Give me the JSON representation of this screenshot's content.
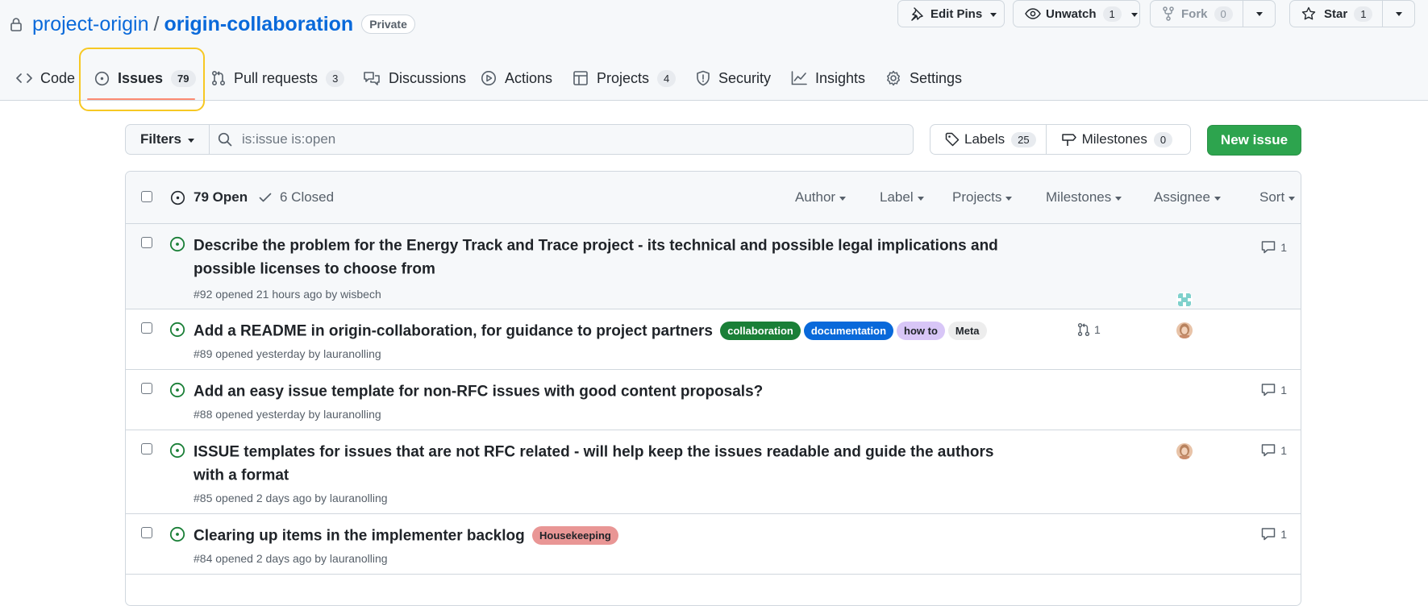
{
  "repo": {
    "owner": "project-origin",
    "separator": "/",
    "name": "origin-collaboration",
    "visibility": "Private"
  },
  "actions": {
    "edit_pins": "Edit Pins",
    "unwatch": "Unwatch",
    "unwatch_count": "1",
    "fork": "Fork",
    "fork_count": "0",
    "star": "Star",
    "star_count": "1"
  },
  "tabs": [
    {
      "label": "Code",
      "icon": "code-icon"
    },
    {
      "label": "Issues",
      "icon": "issue-opened-icon",
      "count": "79",
      "active": true
    },
    {
      "label": "Pull requests",
      "icon": "git-pull-request-icon",
      "count": "3"
    },
    {
      "label": "Discussions",
      "icon": "comment-discussion-icon"
    },
    {
      "label": "Actions",
      "icon": "play-icon"
    },
    {
      "label": "Projects",
      "icon": "table-icon",
      "count": "4"
    },
    {
      "label": "Security",
      "icon": "shield-icon"
    },
    {
      "label": "Insights",
      "icon": "graph-icon"
    },
    {
      "label": "Settings",
      "icon": "gear-icon"
    }
  ],
  "toolbar": {
    "filters_label": "Filters",
    "search_value": "is:issue is:open",
    "labels_label": "Labels",
    "labels_count": "25",
    "milestones_label": "Milestones",
    "milestones_count": "0",
    "new_issue_label": "New issue"
  },
  "list_header": {
    "open_label": "79 Open",
    "closed_label": "6 Closed",
    "filters": [
      "Author",
      "Label",
      "Projects",
      "Milestones",
      "Assignee",
      "Sort"
    ]
  },
  "issues": [
    {
      "title": "Describe the problem for the Energy Track and Trace project - its technical and possible legal implications and possible licenses to choose from",
      "meta": "#92 opened 21 hours ago by wisbech",
      "comments": "1",
      "labels": []
    },
    {
      "title": "Add a README in origin-collaboration, for guidance to project partners",
      "meta": "#89 opened yesterday by lauranolling",
      "comments": "",
      "linked_prs": "1",
      "labels": [
        {
          "name": "collaboration",
          "bg": "#1a7f37",
          "fg": "#ffffff"
        },
        {
          "name": "documentation",
          "bg": "#0969da",
          "fg": "#ffffff"
        },
        {
          "name": "how to",
          "bg": "#d8c6f7",
          "fg": "#1f2328"
        },
        {
          "name": "Meta",
          "bg": "#ededed",
          "fg": "#1f2328"
        }
      ]
    },
    {
      "title": "Add an easy issue template for non-RFC issues with good content proposals?",
      "meta": "#88 opened yesterday by lauranolling",
      "comments": "1",
      "labels": []
    },
    {
      "title": "ISSUE templates for issues that are not RFC related - will help keep the issues readable and guide the authors with a format",
      "meta": "#85 opened 2 days ago by lauranolling",
      "comments": "1",
      "labels": []
    },
    {
      "title": "Clearing up items in the implementer backlog",
      "meta": "#84 opened 2 days ago by lauranolling",
      "comments": "1",
      "labels": [
        {
          "name": "Housekeeping",
          "bg": "#e99695",
          "fg": "#1f2328"
        }
      ]
    }
  ],
  "colors": {
    "open": "#1a7f37",
    "primary": "#2da44e",
    "link": "#0969da",
    "highlight": "#f7c823",
    "tab_underline": "#fd8c73"
  }
}
